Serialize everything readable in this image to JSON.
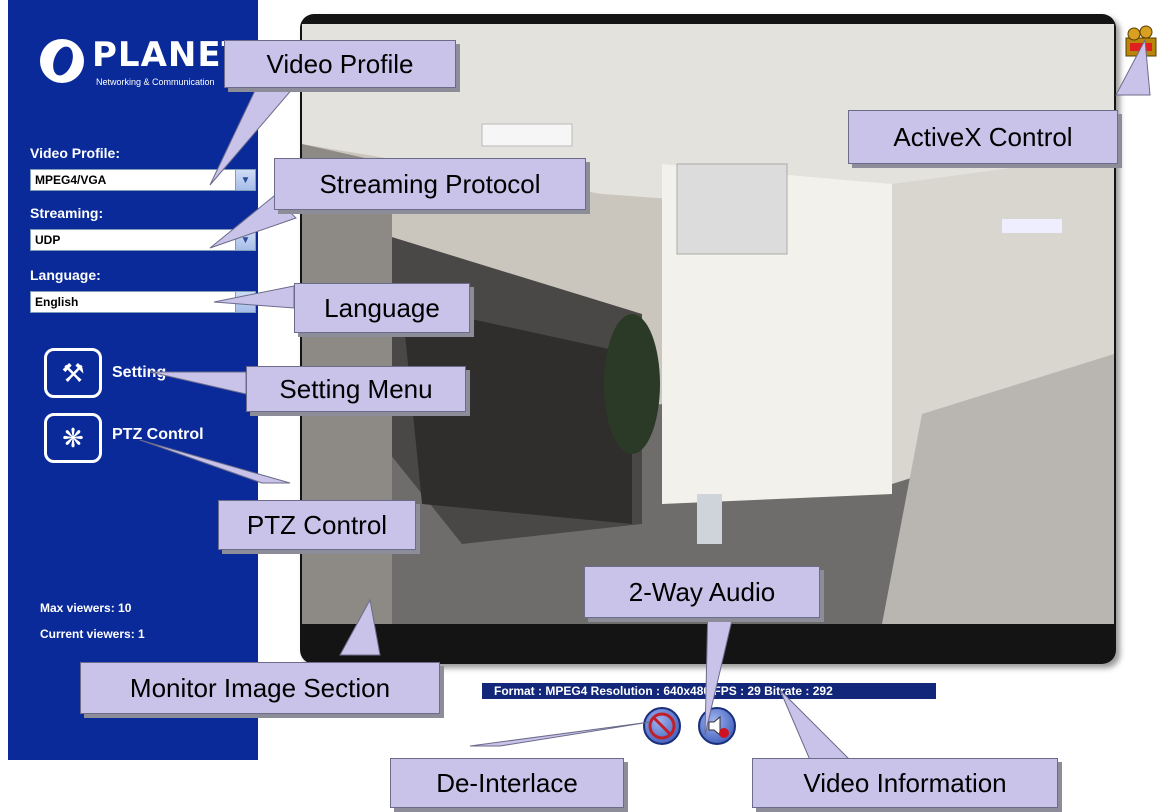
{
  "sidebar": {
    "logo_text": "PLANET",
    "logo_tagline": "Networking & Communication",
    "video_profile": {
      "label": "Video Profile:",
      "value": "MPEG4/VGA"
    },
    "streaming": {
      "label": "Streaming:",
      "value": "UDP"
    },
    "language": {
      "label": "Language:",
      "value": "English"
    },
    "setting_label": "Setting",
    "ptz_label": "PTZ Control",
    "max_viewers": "Max viewers: 10",
    "current_viewers": "Current viewers:  1"
  },
  "info_bar": "Format : MPEG4   Resolution : 640x480   FPS : 29   Bitrate : 292",
  "buttons": {
    "deinterlace_label": "De-Interlace"
  },
  "callouts": {
    "video_profile": "Video Profile",
    "streaming_protocol": "Streaming Protocol",
    "language": "Language",
    "setting_menu": "Setting Menu",
    "ptz_control": "PTZ Control",
    "activex": "ActiveX Control",
    "two_way_audio": "2-Way Audio",
    "monitor_image": "Monitor Image Section",
    "de_interlace": "De-Interlace",
    "video_info": "Video Information"
  },
  "colors": {
    "sidebar": "#0a2a99",
    "callout_fill": "#c9c3ea",
    "info_bar": "#12267a"
  }
}
